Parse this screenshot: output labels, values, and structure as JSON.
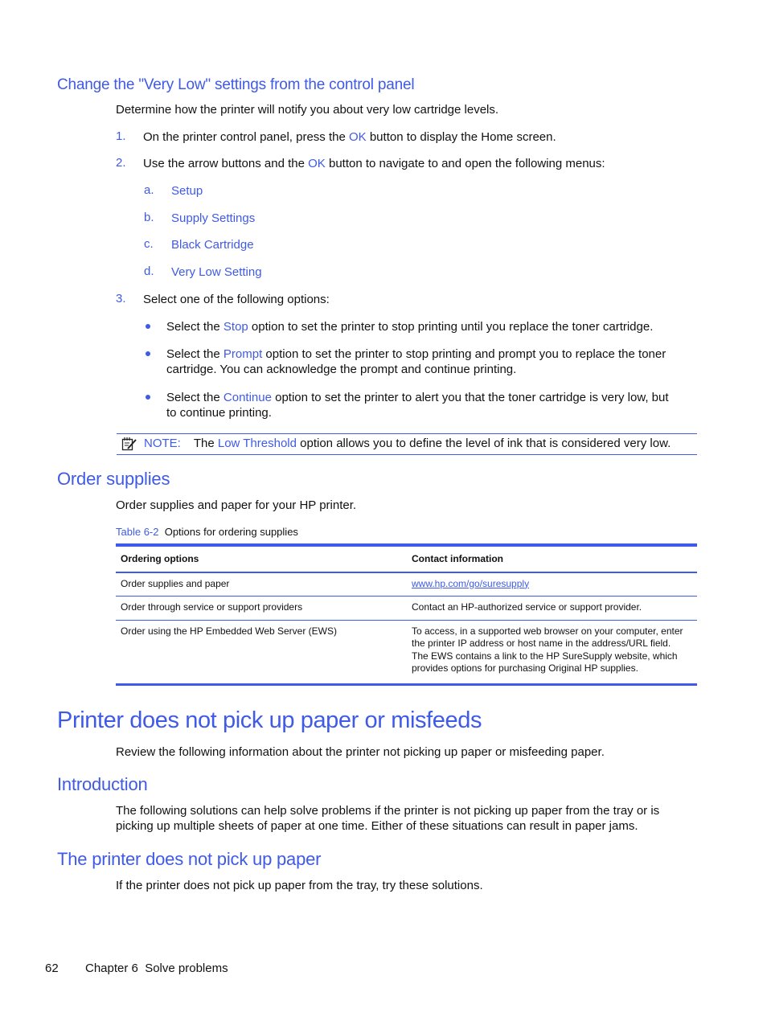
{
  "section_very_low": {
    "heading": "Change the \"Very Low\" settings from the control panel",
    "intro": "Determine how the printer will notify you about very low cartridge levels.",
    "steps": [
      {
        "num": "1.",
        "pre": "On the printer control panel, press the ",
        "hl": "OK",
        "post": " button to display the Home screen."
      },
      {
        "num": "2.",
        "pre": "Use the arrow buttons and the ",
        "hl": "OK",
        "post": " button to navigate to and open the following menus:"
      },
      {
        "num": "3.",
        "text": "Select one of the following options:"
      }
    ],
    "menus": [
      {
        "letter": "a.",
        "label": "Setup"
      },
      {
        "letter": "b.",
        "label": "Supply Settings"
      },
      {
        "letter": "c.",
        "label": "Black Cartridge"
      },
      {
        "letter": "d.",
        "label": "Very Low Setting"
      }
    ],
    "options": [
      {
        "pre": "Select the ",
        "hl": "Stop",
        "post": " option to set the printer to stop printing until you replace the toner cartridge."
      },
      {
        "pre": "Select the ",
        "hl": "Prompt",
        "post": " option to set the printer to stop printing and prompt you to replace the toner",
        "line2": "cartridge. You can acknowledge the prompt and continue printing."
      },
      {
        "pre": "Select the ",
        "hl": "Continue",
        "post": " option to set the printer to alert you that the toner cartridge is very low, but",
        "line2": "to continue printing."
      }
    ],
    "note": {
      "icon": "note-icon",
      "label": "NOTE:",
      "pre": "The ",
      "hl": "Low Threshold",
      "post": " option allows you to define the level of ink that is considered very low."
    }
  },
  "section_order": {
    "heading": "Order supplies",
    "intro": "Order supplies and paper for your HP printer.",
    "table": {
      "caption_num": "Table 6-2",
      "caption_title": "Options for ordering supplies",
      "headers": [
        "Ordering options",
        "Contact information"
      ],
      "rows": [
        {
          "option": "Order supplies and paper",
          "contact": "www.hp.com/go/suresupply",
          "is_link": true
        },
        {
          "option": "Order through service or support providers",
          "contact": "Contact an HP-authorized service or support provider."
        },
        {
          "option": "Order using the HP Embedded Web Server (EWS)",
          "contact": "To access, in a supported web browser on your computer, enter the printer IP address or host name in the address/URL field. The EWS contains a link to the HP SureSupply website, which provides options for purchasing Original HP supplies."
        }
      ]
    }
  },
  "section_misfeed": {
    "heading": "Printer does not pick up paper or misfeeds",
    "intro": "Review the following information about the printer not picking up paper or misfeeding paper."
  },
  "section_intro": {
    "heading": "Introduction",
    "line1": "The following solutions can help solve problems if the printer is not picking up paper from the tray or is",
    "line2": "picking up multiple sheets of paper at one time. Either of these situations can result in paper jams."
  },
  "section_nopick": {
    "heading": "The printer does not pick up paper",
    "intro": "If the printer does not pick up paper from the tray, try these solutions."
  },
  "footer": {
    "page": "62",
    "chapter": "Chapter 6  Solve problems"
  }
}
